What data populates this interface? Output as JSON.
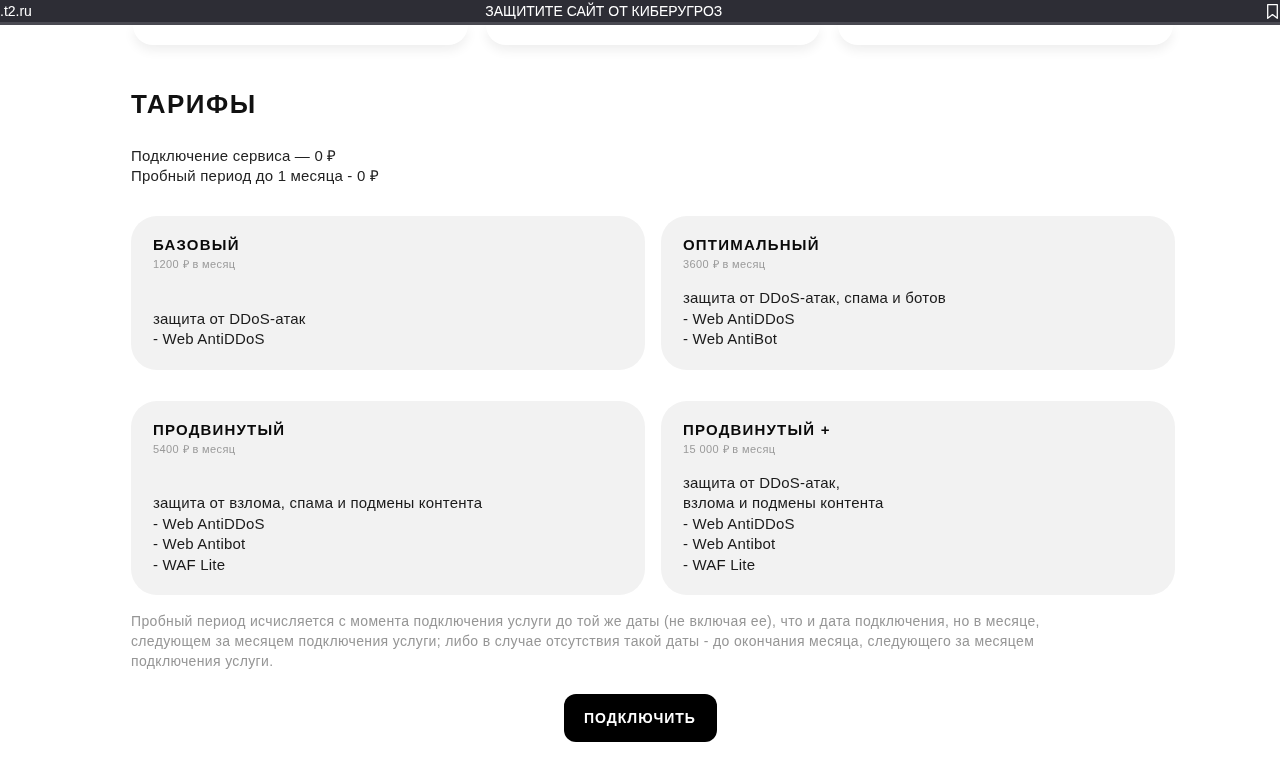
{
  "browser_bar": {
    "url": ".t2.ru",
    "title": "ЗАЩИТИТЕ САЙТ ОТ КИБЕРУГРОЗ"
  },
  "tariffs": {
    "heading": "ТАРИФЫ",
    "intro": [
      "Подключение сервиса — 0 ₽",
      "Пробный период до 1 месяца - 0 ₽"
    ],
    "plans": [
      {
        "name": "БАЗОВЫЙ",
        "price": "1200 ₽ в месяц",
        "description": "защита от DDoS-атак",
        "features": [
          "- Web AntiDDoS"
        ]
      },
      {
        "name": "ОПТИМАЛЬНЫЙ",
        "price": "3600 ₽ в месяц",
        "description": "защита от DDoS-атак, спама и ботов",
        "features": [
          "- Web AntiDDoS",
          "- Web AntiBot"
        ]
      },
      {
        "name": "ПРОДВИНУТЫЙ",
        "price": "5400 ₽ в месяц",
        "description": "защита от взлома, спама и подмены контента",
        "features": [
          "- Web AntiDDoS",
          "- Web Antibot",
          "- WAF Lite"
        ]
      },
      {
        "name": "ПРОДВИНУТЫЙ +",
        "price": "15 000 ₽ в месяц",
        "description": "защита от DDoS-атак,\nвзлома и подмены контента",
        "features": [
          "- Web AntiDDoS",
          "- Web Antibot",
          "- WAF Lite"
        ]
      }
    ],
    "note": "Пробный период исчисляется с момента подключения услуги до той же даты (не включая ее), что и дата подключения, но в месяце,\nследующем за месяцем подключения услуги; либо в случае отсутствия такой даты - до окончания месяца, следующего за месяцем\nподключения услуги.",
    "button": "ПОДКЛЮЧИТЬ"
  }
}
